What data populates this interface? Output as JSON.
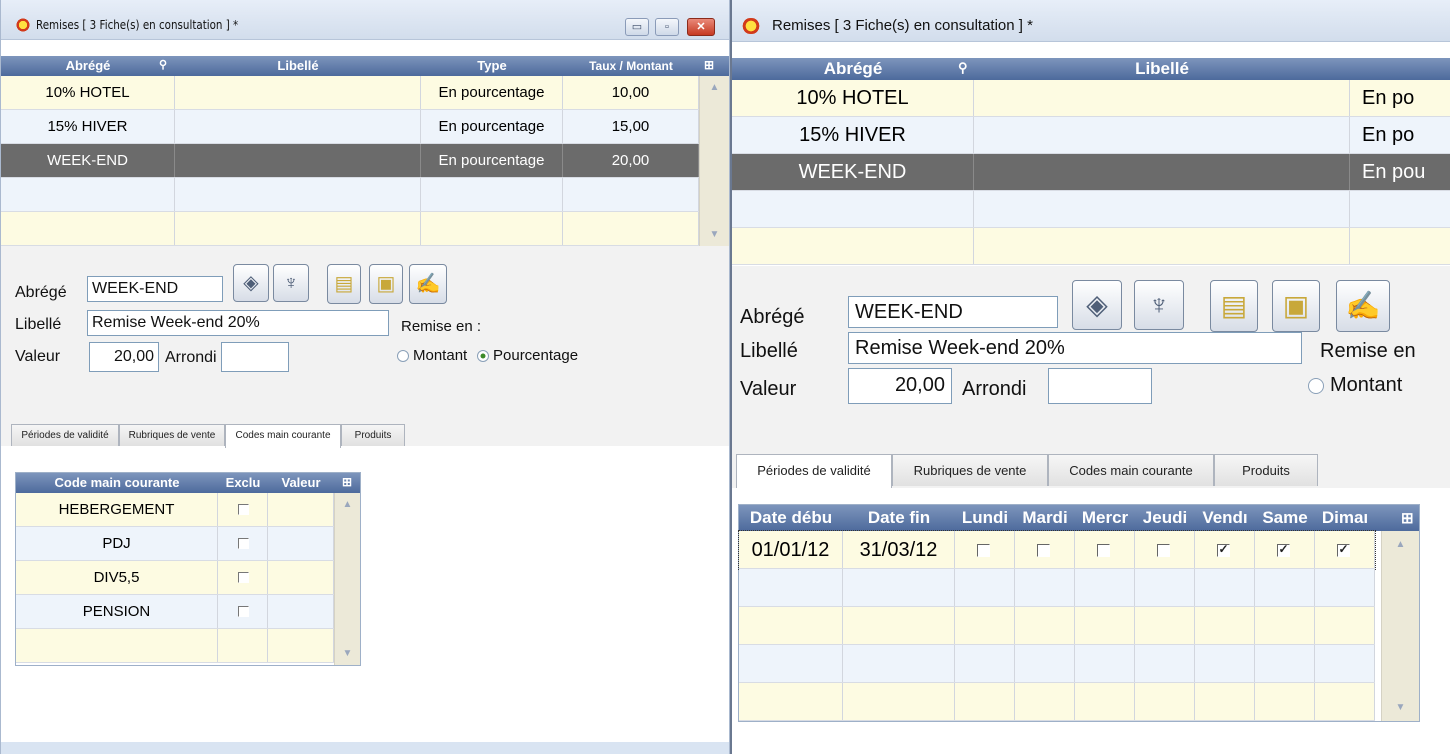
{
  "left_window": {
    "title": "Remises  [ 3 Fiche(s) en consultation ] *",
    "window_buttons": {
      "minimize": "▭",
      "restore": "▫",
      "close": "✕"
    },
    "table": {
      "headers": [
        "Abrégé",
        "Libellé",
        "Type",
        "Taux / Montant"
      ],
      "rows": [
        {
          "abrege": "10% HOTEL",
          "libelle": "",
          "type": "En pourcentage",
          "taux": "10,00"
        },
        {
          "abrege": "15% HIVER",
          "libelle": "",
          "type": "En pourcentage",
          "taux": "15,00"
        },
        {
          "abrege": "WEEK-END",
          "libelle": "",
          "type": "En pourcentage",
          "taux": "20,00"
        }
      ]
    },
    "form": {
      "abrege_label": "Abrégé",
      "abrege_value": "WEEK-END",
      "libelle_label": "Libellé",
      "libelle_value": "Remise Week-end 20%",
      "valeur_label": "Valeur",
      "valeur_value": "20,00",
      "arrondi_label": "Arrondi",
      "arrondi_value": "",
      "remise_label": "Remise en :",
      "montant_label": "Montant",
      "pourcentage_label": "Pourcentage"
    },
    "tabs": [
      "Périodes de validité",
      "Rubriques de vente",
      "Codes main courante",
      "Produits"
    ],
    "active_tab": 2,
    "sub_table": {
      "headers": [
        "Code main courante",
        "Exclu",
        "Valeur"
      ],
      "rows": [
        {
          "code": "HEBERGEMENT",
          "exclu": false,
          "valeur": ""
        },
        {
          "code": "PDJ",
          "exclu": false,
          "valeur": ""
        },
        {
          "code": "DIV5,5",
          "exclu": false,
          "valeur": ""
        },
        {
          "code": "PENSION",
          "exclu": false,
          "valeur": ""
        }
      ]
    }
  },
  "right_window": {
    "title": "Remises  [ 3 Fiche(s) en consultation ] *",
    "table": {
      "headers": [
        "Abrégé",
        "Libellé"
      ],
      "rows": [
        {
          "abrege": "10% HOTEL",
          "libelle": "",
          "type": "En po"
        },
        {
          "abrege": "15% HIVER",
          "libelle": "",
          "type": "En po"
        },
        {
          "abrege": "WEEK-END",
          "libelle": "",
          "type": "En pou"
        }
      ]
    },
    "form": {
      "abrege_label": "Abrégé",
      "abrege_value": "WEEK-END",
      "libelle_label": "Libellé",
      "libelle_value": "Remise Week-end 20%",
      "valeur_label": "Valeur",
      "valeur_value": "20,00",
      "arrondi_label": "Arrondi",
      "arrondi_value": "",
      "remise_label": "Remise en",
      "montant_label": "Montant"
    },
    "tabs": [
      "Périodes de validité",
      "Rubriques de vente",
      "Codes main courante",
      "Produits"
    ],
    "active_tab": 0,
    "sub_table": {
      "headers": [
        "Date débu",
        "Date fin",
        "Lundi",
        "Mardi",
        "Mercr",
        "Jeudi",
        "Vendı",
        "Same",
        "Dimaı"
      ],
      "rows": [
        {
          "debut": "01/01/12",
          "fin": "31/03/12",
          "days": [
            false,
            false,
            false,
            false,
            true,
            true,
            true
          ]
        }
      ]
    }
  },
  "colors": {
    "header_blue": "#5b76a8",
    "selected_row": "#6b6b6b",
    "row_yellow": "#fdfbe2",
    "row_blue": "#eef4fb"
  },
  "icons": [
    "app-icon",
    "eraser-icon",
    "trash-icon",
    "new-record-icon",
    "duplicate-icon",
    "edit-icon",
    "column-picker-icon"
  ]
}
